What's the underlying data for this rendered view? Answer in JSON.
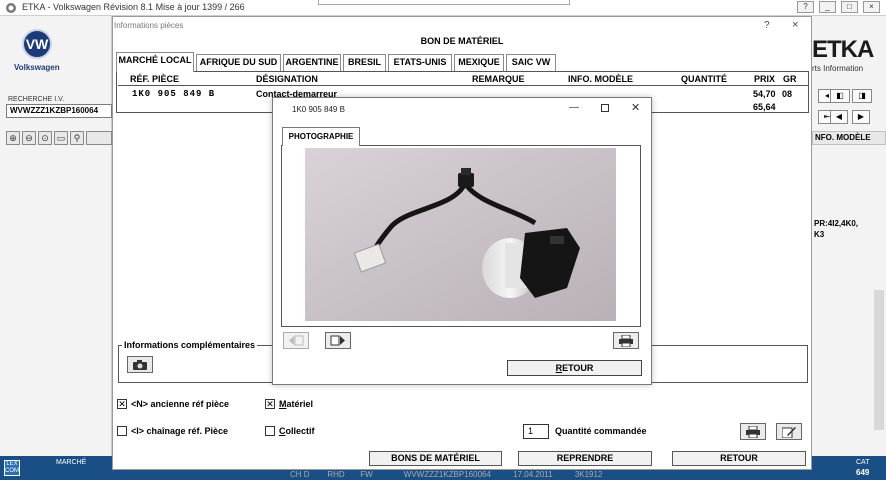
{
  "app": {
    "title": "ETKA - Volkswagen Révision 8.1 Mise à jour 1399 / 266",
    "brand_label": "Volkswagen",
    "logo_text": "VW",
    "etka_logo": "ETKA",
    "etka_sub": "rts Information",
    "window_buttons": [
      "?",
      "_",
      "□",
      "×"
    ]
  },
  "left_panel": {
    "search_label": "RECHERCHE I.V.",
    "vin_value": "WVWZZZ1KZBP160064"
  },
  "right_panel": {
    "info_modele": "NFO. MODÈLE",
    "pr_code": "PR:4I2,4K0,\nK3"
  },
  "status_bar": {
    "marche_label": "MARCHÉ",
    "cat_label": "CAT",
    "cat_value": "649",
    "lex_logo": "LEX COM",
    "behind_text": "CH D        RHD       FW              WVWZZZ1KZBP160064          17.04.2011          3K1912"
  },
  "main_dialog": {
    "title": "Informations pièces",
    "help": "?",
    "close": "×",
    "heading": "BON DE MATÉRIEL",
    "tabs": [
      {
        "label": "MARCHÉ LOCAL",
        "active": true
      },
      {
        "label": "AFRIQUE DU SUD",
        "active": false
      },
      {
        "label": "ARGENTINE",
        "active": false
      },
      {
        "label": "BRESIL",
        "active": false
      },
      {
        "label": "ETATS-UNIS",
        "active": false
      },
      {
        "label": "MEXIQUE",
        "active": false
      },
      {
        "label": "SAIC VW",
        "active": false
      }
    ],
    "columns": {
      "ref": "RÉF. PIÈCE",
      "designation": "DÉSIGNATION",
      "remarque": "REMARQUE",
      "info_modele": "INFO. MODÈLE",
      "quantite": "QUANTITÉ",
      "prix": "PRIX",
      "gr": "GR"
    },
    "row": {
      "ref": "1K0 905 849 B",
      "designation": "Contact-demarreur",
      "prix": "54,70",
      "prix2": "65,64",
      "gr": "08"
    },
    "info_complementaires": "Informations complémentaires",
    "checkboxes": {
      "ancienne_label": "<N> ancienne réf pièce",
      "ancienne_checked": "✕",
      "materiel_label": "Matériel",
      "materiel_checked": "✕",
      "chainage_label": "<I> chaînage réf. Pièce",
      "collectif_label": "Collectif"
    },
    "quantity": {
      "value": "1",
      "label": "Quantité commandée"
    },
    "buttons": {
      "bons": "BONS DE MATÉRIEL",
      "reprendre": "REPRENDRE",
      "retour": "RETOUR"
    }
  },
  "photo_popup": {
    "title": "1K0 905 849 B",
    "tab": "PHOTOGRAPHIE",
    "retour": "RETOUR"
  }
}
